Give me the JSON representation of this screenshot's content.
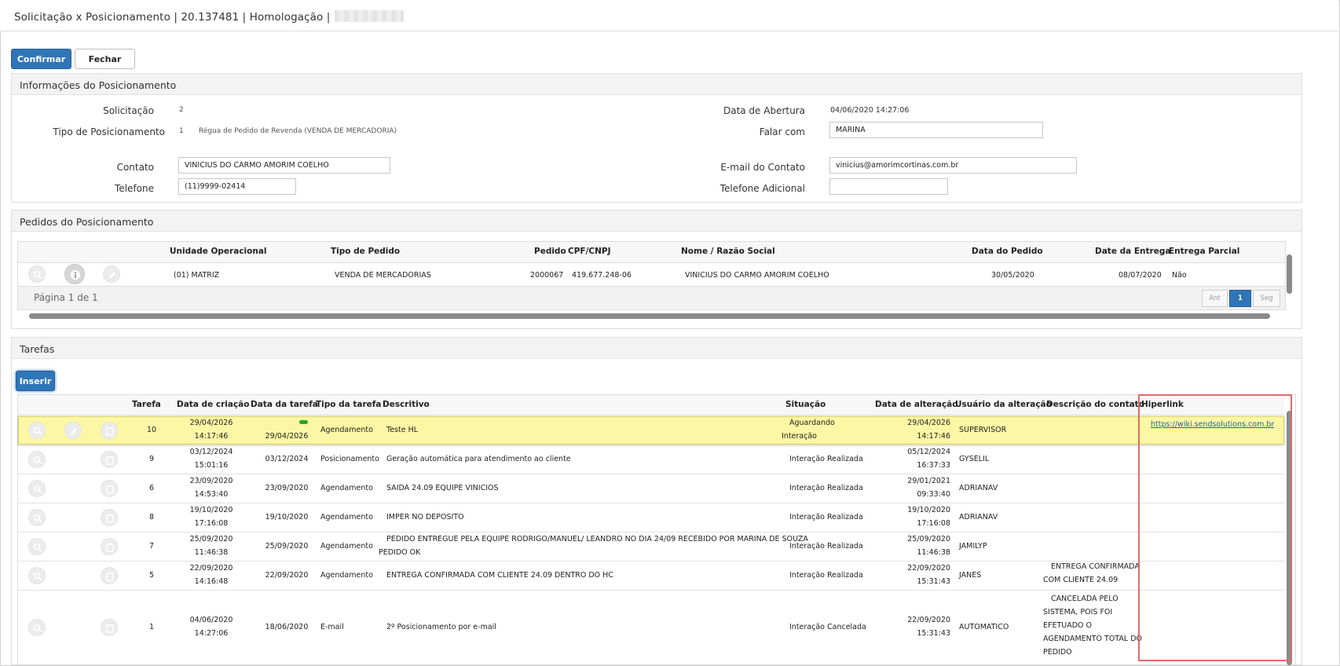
{
  "window": {
    "title": "Solicitação x Posicionamento | 20.137481 | Homologação |"
  },
  "toolbar": {
    "confirm_label": "Confirmar",
    "close_label": "Fechar"
  },
  "info_panel": {
    "title": "Informações do Posicionamento",
    "solicitacao_label": "Solicitação",
    "solicitacao_value": "2",
    "tipo_label": "Tipo de Posicionamento",
    "tipo_code": "1",
    "tipo_value": "Régua de Pedido de Revenda (VENDA DE MERCADORIA)",
    "contato_label": "Contato",
    "contato_value": "VINICIUS DO CARMO AMORIM COELHO",
    "telefone_label": "Telefone",
    "telefone_value": "(11)9999-02414",
    "abertura_label": "Data de Abertura",
    "abertura_value": "04/06/2020 14:27:06",
    "falar_label": "Falar com",
    "falar_value": "MARINA",
    "email_label": "E-mail do Contato",
    "email_value": "vinicius@amorimcortinas.com.br",
    "tel_adic_label": "Telefone Adicional",
    "tel_adic_value": ""
  },
  "orders_panel": {
    "title": "Pedidos do Posicionamento",
    "headers": [
      "Unidade Operacional",
      "Tipo de Pedido",
      "Pedido",
      "CPF/CNPJ",
      "Nome / Razão Social",
      "Data do Pedido",
      "Date da Entrega",
      "Entrega Parcial"
    ],
    "row": {
      "unidade": "(01) MATRIZ",
      "tipo": "VENDA DE MERCADORIAS",
      "pedido": "2000067",
      "cpf": "419.677.248-06",
      "nome": "VINICIUS DO CARMO AMORIM COELHO",
      "data_pedido": "30/05/2020",
      "data_entrega": "08/07/2020",
      "parcial": "Não"
    },
    "pager": {
      "label": "Página 1 de 1",
      "prev": "Ant",
      "page": "1",
      "next": "Seg"
    }
  },
  "tasks_panel": {
    "title": "Tarefas",
    "insert_label": "Inserir",
    "headers": [
      "Tarefa",
      "Data de criação",
      "Data da tarefa",
      "Tipo da tarefa",
      "Descritivo",
      "Situação",
      "Data de alteração",
      "Usuário da alteração",
      "Descrição do contato",
      "Hiperlink"
    ],
    "rows": [
      {
        "tarefa": "10",
        "criacao_d": "29/04/2026",
        "criacao_t": "14:17:46",
        "data_tarefa": "29/04/2026",
        "tipo": "Agendamento",
        "descritivo": "Teste HL",
        "descritivo2": "",
        "situacao": "Aguardando",
        "situacao2": "Interação",
        "alt_d": "29/04/2026",
        "alt_t": "14:17:46",
        "usuario": "SUPERVISOR",
        "contato": [
          "",
          "",
          "",
          "",
          ""
        ],
        "link": "https://wiki.sendsolutions.com.br"
      },
      {
        "tarefa": "9",
        "criacao_d": "03/12/2024",
        "criacao_t": "15:01:16",
        "data_tarefa": "03/12/2024",
        "tipo": "Posicionamento",
        "descritivo": "Geração automática para atendimento ao cliente",
        "descritivo2": "",
        "situacao": "Interação Realizada",
        "situacao2": "",
        "alt_d": "05/12/2024",
        "alt_t": "16:37:33",
        "usuario": "GYSELIL",
        "contato": [
          "",
          "",
          "",
          "",
          ""
        ],
        "link": ""
      },
      {
        "tarefa": "6",
        "criacao_d": "23/09/2020",
        "criacao_t": "14:53:40",
        "data_tarefa": "23/09/2020",
        "tipo": "Agendamento",
        "descritivo": "SAIDA 24.09 EQUIPE VINICIOS",
        "descritivo2": "",
        "situacao": "Interação Realizada",
        "situacao2": "",
        "alt_d": "29/01/2021",
        "alt_t": "09:33:40",
        "usuario": "ADRIANAV",
        "contato": [
          "",
          "",
          "",
          "",
          ""
        ],
        "link": ""
      },
      {
        "tarefa": "8",
        "criacao_d": "19/10/2020",
        "criacao_t": "17:16:08",
        "data_tarefa": "19/10/2020",
        "tipo": "Agendamento",
        "descritivo": "IMPER NO DEPOSITO",
        "descritivo2": "",
        "situacao": "Interação Realizada",
        "situacao2": "",
        "alt_d": "19/10/2020",
        "alt_t": "17:16:08",
        "usuario": "ADRIANAV",
        "contato": [
          "",
          "",
          "",
          "",
          ""
        ],
        "link": ""
      },
      {
        "tarefa": "7",
        "criacao_d": "25/09/2020",
        "criacao_t": "11:46:38",
        "data_tarefa": "25/09/2020",
        "tipo": "Agendamento",
        "descritivo": "PEDIDO ENTREGUE PELA EQUIPE RODRIGO/MANUEL/ LEANDRO NO DIA 24/09 RECEBIDO POR MARINA DE SOUZA",
        "descritivo2": "PEDIDO OK",
        "situacao": "Interação Realizada",
        "situacao2": "",
        "alt_d": "25/09/2020",
        "alt_t": "11:46:38",
        "usuario": "JAMILYP",
        "contato": [
          "",
          "",
          "",
          "",
          ""
        ],
        "link": ""
      },
      {
        "tarefa": "5",
        "criacao_d": "22/09/2020",
        "criacao_t": "14:16:48",
        "data_tarefa": "22/09/2020",
        "tipo": "Agendamento",
        "descritivo": "ENTREGA CONFIRMADA COM CLIENTE 24.09 DENTRO DO HC",
        "descritivo2": "",
        "situacao": "Interação Realizada",
        "situacao2": "",
        "alt_d": "22/09/2020",
        "alt_t": "15:31:43",
        "usuario": "JANES",
        "contato": [
          "ENTREGA CONFIRMADA",
          "COM CLIENTE 24.09",
          "",
          "",
          ""
        ],
        "link": ""
      },
      {
        "tarefa": "1",
        "criacao_d": "04/06/2020",
        "criacao_t": "14:27:06",
        "data_tarefa": "18/06/2020",
        "tipo": "E-mail",
        "descritivo": "2º Posicionamento por e-mail",
        "descritivo2": "",
        "situacao": "Interação Cancelada",
        "situacao2": "",
        "alt_d": "22/09/2020",
        "alt_t": "15:31:43",
        "usuario": "AUTOMATICO",
        "contato": [
          "CANCELADA PELO",
          "SISTEMA, POIS FOI",
          "EFETUADO O",
          "AGENDAMENTO TOTAL DO",
          "PEDIDO"
        ],
        "link": ""
      }
    ]
  },
  "icons": {
    "view": "search-icon",
    "info": "info-icon",
    "edit": "pencil-icon",
    "attach": "clipboard-icon"
  },
  "colors": {
    "primary": "#2f76b8",
    "highlight": "#fbf7a4",
    "annotation": "#e06a6a",
    "link": "#2163a8"
  }
}
